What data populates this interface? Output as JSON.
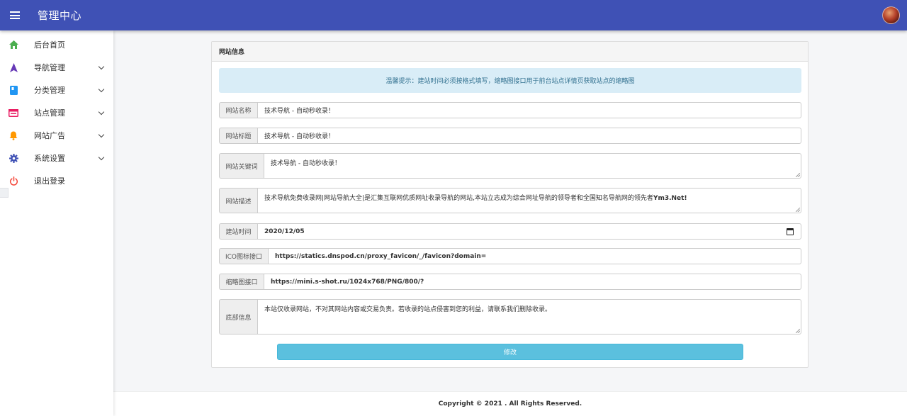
{
  "app": {
    "title": "管理中心"
  },
  "sidebar": {
    "items": [
      {
        "label": "后台首页",
        "icon": "home-icon",
        "color": "#4caf50",
        "expandable": false
      },
      {
        "label": "导航管理",
        "icon": "navigation-arrow-icon",
        "color": "#673ab7",
        "expandable": true
      },
      {
        "label": "分类管理",
        "icon": "book-icon",
        "color": "#2196f3",
        "expandable": true
      },
      {
        "label": "站点管理",
        "icon": "web-window-icon",
        "color": "#e91e63",
        "expandable": true
      },
      {
        "label": "网站广告",
        "icon": "bell-icon",
        "color": "#ff9800",
        "expandable": true
      },
      {
        "label": "系统设置",
        "icon": "gear-icon",
        "color": "#3f51b5",
        "expandable": true
      },
      {
        "label": "退出登录",
        "icon": "power-icon",
        "color": "#f44336",
        "expandable": false
      }
    ]
  },
  "panel": {
    "heading": "网站信息",
    "tip": "温馨提示：建站时间必须按格式填写，缩略图接口用于前台站点详情页获取站点的缩略图",
    "fields": {
      "site_name": {
        "label": "网站名称",
        "value": "技术导航 - 自动秒收录！"
      },
      "site_title": {
        "label": "网站标题",
        "value": "技术导航 - 自动秒收录！"
      },
      "keywords": {
        "label": "网站关键词",
        "value": "技术导航 - 自动秒收录！"
      },
      "description": {
        "label": "网站描述",
        "value": "技术导航免费收录网|网站导航大全|是汇集互联网优质网址收录导航的网站,本站立志成为综合网址导航的领导者和全国知名导航网的领先者",
        "value_bold": "Ym3.Net!"
      },
      "build_date": {
        "label": "建站时间",
        "value": "2020/12/05"
      },
      "ico_api": {
        "label": "ICO图标接口",
        "value": "https://statics.dnspod.cn/proxy_favicon/_/favicon?domain="
      },
      "thumb_api": {
        "label": "缩略图接口",
        "value": "https://mini.s-shot.ru/1024x768/PNG/800/?"
      },
      "footer_info": {
        "label": "底部信息",
        "value": "本站仅收录网站，不对其网站内容或交易负责。若收录的站点侵害到您的利益，请联系我们删除收录。"
      }
    },
    "submit_label": "修改"
  },
  "footer": {
    "copyright": "Copyright © 2021 . All Rights Reserved."
  }
}
